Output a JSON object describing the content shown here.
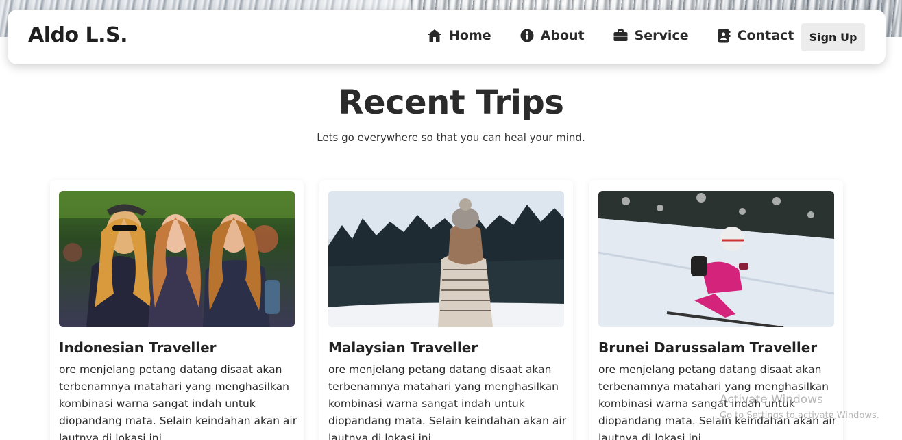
{
  "nav": {
    "logo": "Aldo L.S.",
    "items": [
      {
        "label": "Home",
        "icon": "home-icon"
      },
      {
        "label": "About",
        "icon": "info-icon"
      },
      {
        "label": "Service",
        "icon": "briefcase-icon"
      },
      {
        "label": "Contact",
        "icon": "contact-book-icon"
      }
    ],
    "signup_label": "Sign Up"
  },
  "section": {
    "title": "Recent Trips",
    "subtitle": "Lets go everywhere so that you can heal your mind."
  },
  "cards": [
    {
      "title": "Indonesian Traveller",
      "image": "friends-at-festival-photo",
      "text": "ore menjelang petang datang disaat akan terbenamnya matahari yang menghasilkan kombinasi warna sangat indah untuk diopandang mata. Selain keindahan akan air lautnya di lokasi ini"
    },
    {
      "title": "Malaysian Traveller",
      "image": "woman-snowy-forest-photo",
      "text": "ore menjelang petang datang disaat akan terbenamnya matahari yang menghasilkan kombinasi warna sangat indah untuk diopandang mata. Selain keindahan akan air lautnya di lokasi ini"
    },
    {
      "title": "Brunei Darussalam Traveller",
      "image": "child-skiing-photo",
      "text": "ore menjelang petang datang disaat akan terbenamnya matahari yang menghasilkan kombinasi warna sangat indah untuk diopandang mata. Selain keindahan akan air lautnya di lokasi ini"
    }
  ],
  "watermark": {
    "line1": "Activate Windows",
    "line2": "Go to Settings to activate Windows."
  },
  "colors": {
    "text": "#222222",
    "button_bg": "#ececec",
    "pink_suit": "#d4237a"
  }
}
